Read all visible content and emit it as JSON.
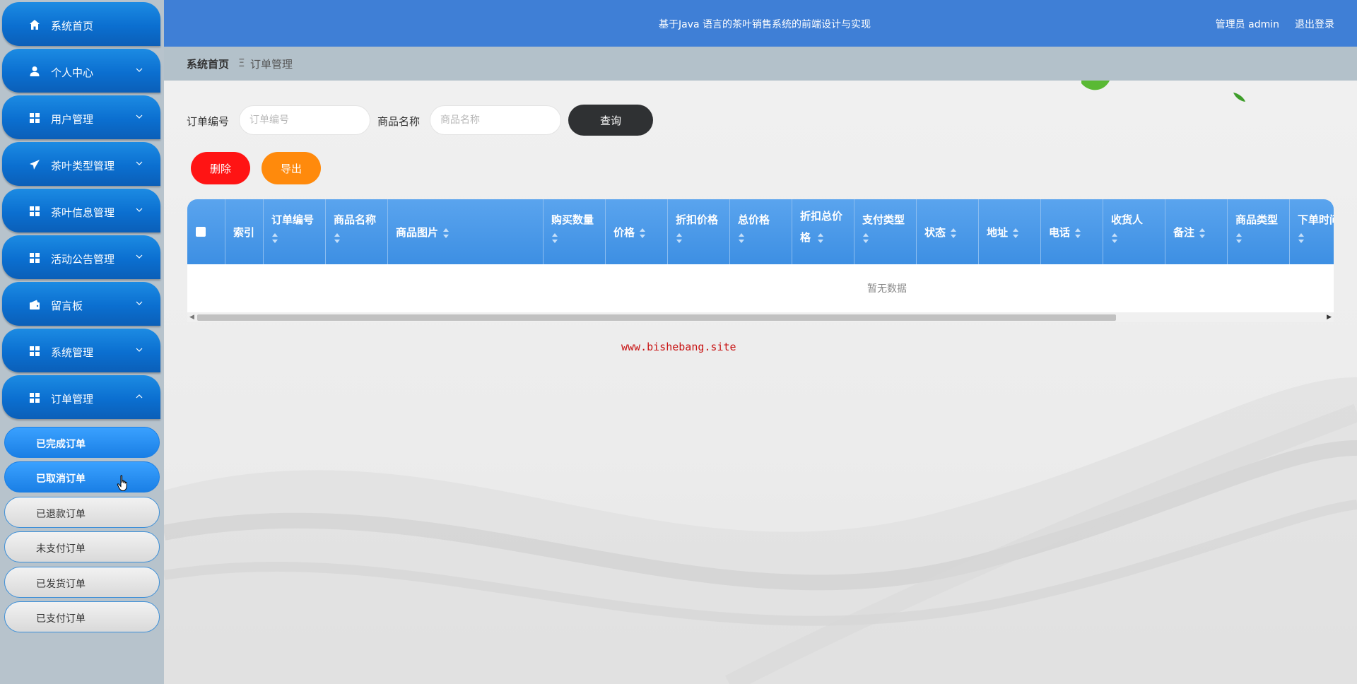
{
  "header": {
    "title": "基于Java 语言的茶叶销售系统的前端设计与实现",
    "user": "管理员 admin",
    "logout": "退出登录"
  },
  "breadcrumb": {
    "home": "系统首页",
    "separator": "Ξ",
    "current": "订单管理"
  },
  "sidebar": {
    "items": [
      {
        "label": "系统首页",
        "icon": "home-icon"
      },
      {
        "label": "个人中心",
        "icon": "user-icon"
      },
      {
        "label": "用户管理",
        "icon": "grid-icon"
      },
      {
        "label": "茶叶类型管理",
        "icon": "paper-plane-icon"
      },
      {
        "label": "茶叶信息管理",
        "icon": "grid-icon"
      },
      {
        "label": "活动公告管理",
        "icon": "grid-icon"
      },
      {
        "label": "留言板",
        "icon": "wallet-icon"
      },
      {
        "label": "系统管理",
        "icon": "grid-icon"
      },
      {
        "label": "订单管理",
        "icon": "grid-icon"
      }
    ],
    "sub_items": [
      {
        "label": "已完成订单",
        "active": true
      },
      {
        "label": "已取消订单",
        "active": true
      },
      {
        "label": "已退款订单",
        "active": false
      },
      {
        "label": "未支付订单",
        "active": false
      },
      {
        "label": "已发货订单",
        "active": false
      },
      {
        "label": "已支付订单",
        "active": false
      }
    ]
  },
  "search": {
    "order_no_label": "订单编号",
    "order_no_placeholder": "订单编号",
    "product_label": "商品名称",
    "product_placeholder": "商品名称",
    "query_button": "查询"
  },
  "actions": {
    "delete": "删除",
    "export": "导出"
  },
  "table": {
    "columns": [
      "索引",
      "订单编号",
      "商品名称",
      "商品图片",
      "购买数量",
      "价格",
      "折扣价格",
      "总价格",
      "折扣总价格",
      "支付类型",
      "状态",
      "地址",
      "电话",
      "收货人",
      "备注",
      "商品类型",
      "下单时间"
    ],
    "empty_text": "暂无数据"
  },
  "watermark": "www.bishebang.site",
  "colors": {
    "header": "#3f7fd6",
    "menu": "#0b6fd0",
    "table_header": "#4a98e8",
    "delete": "#ff1414",
    "export": "#ff8a0c",
    "query": "#2f3133"
  }
}
